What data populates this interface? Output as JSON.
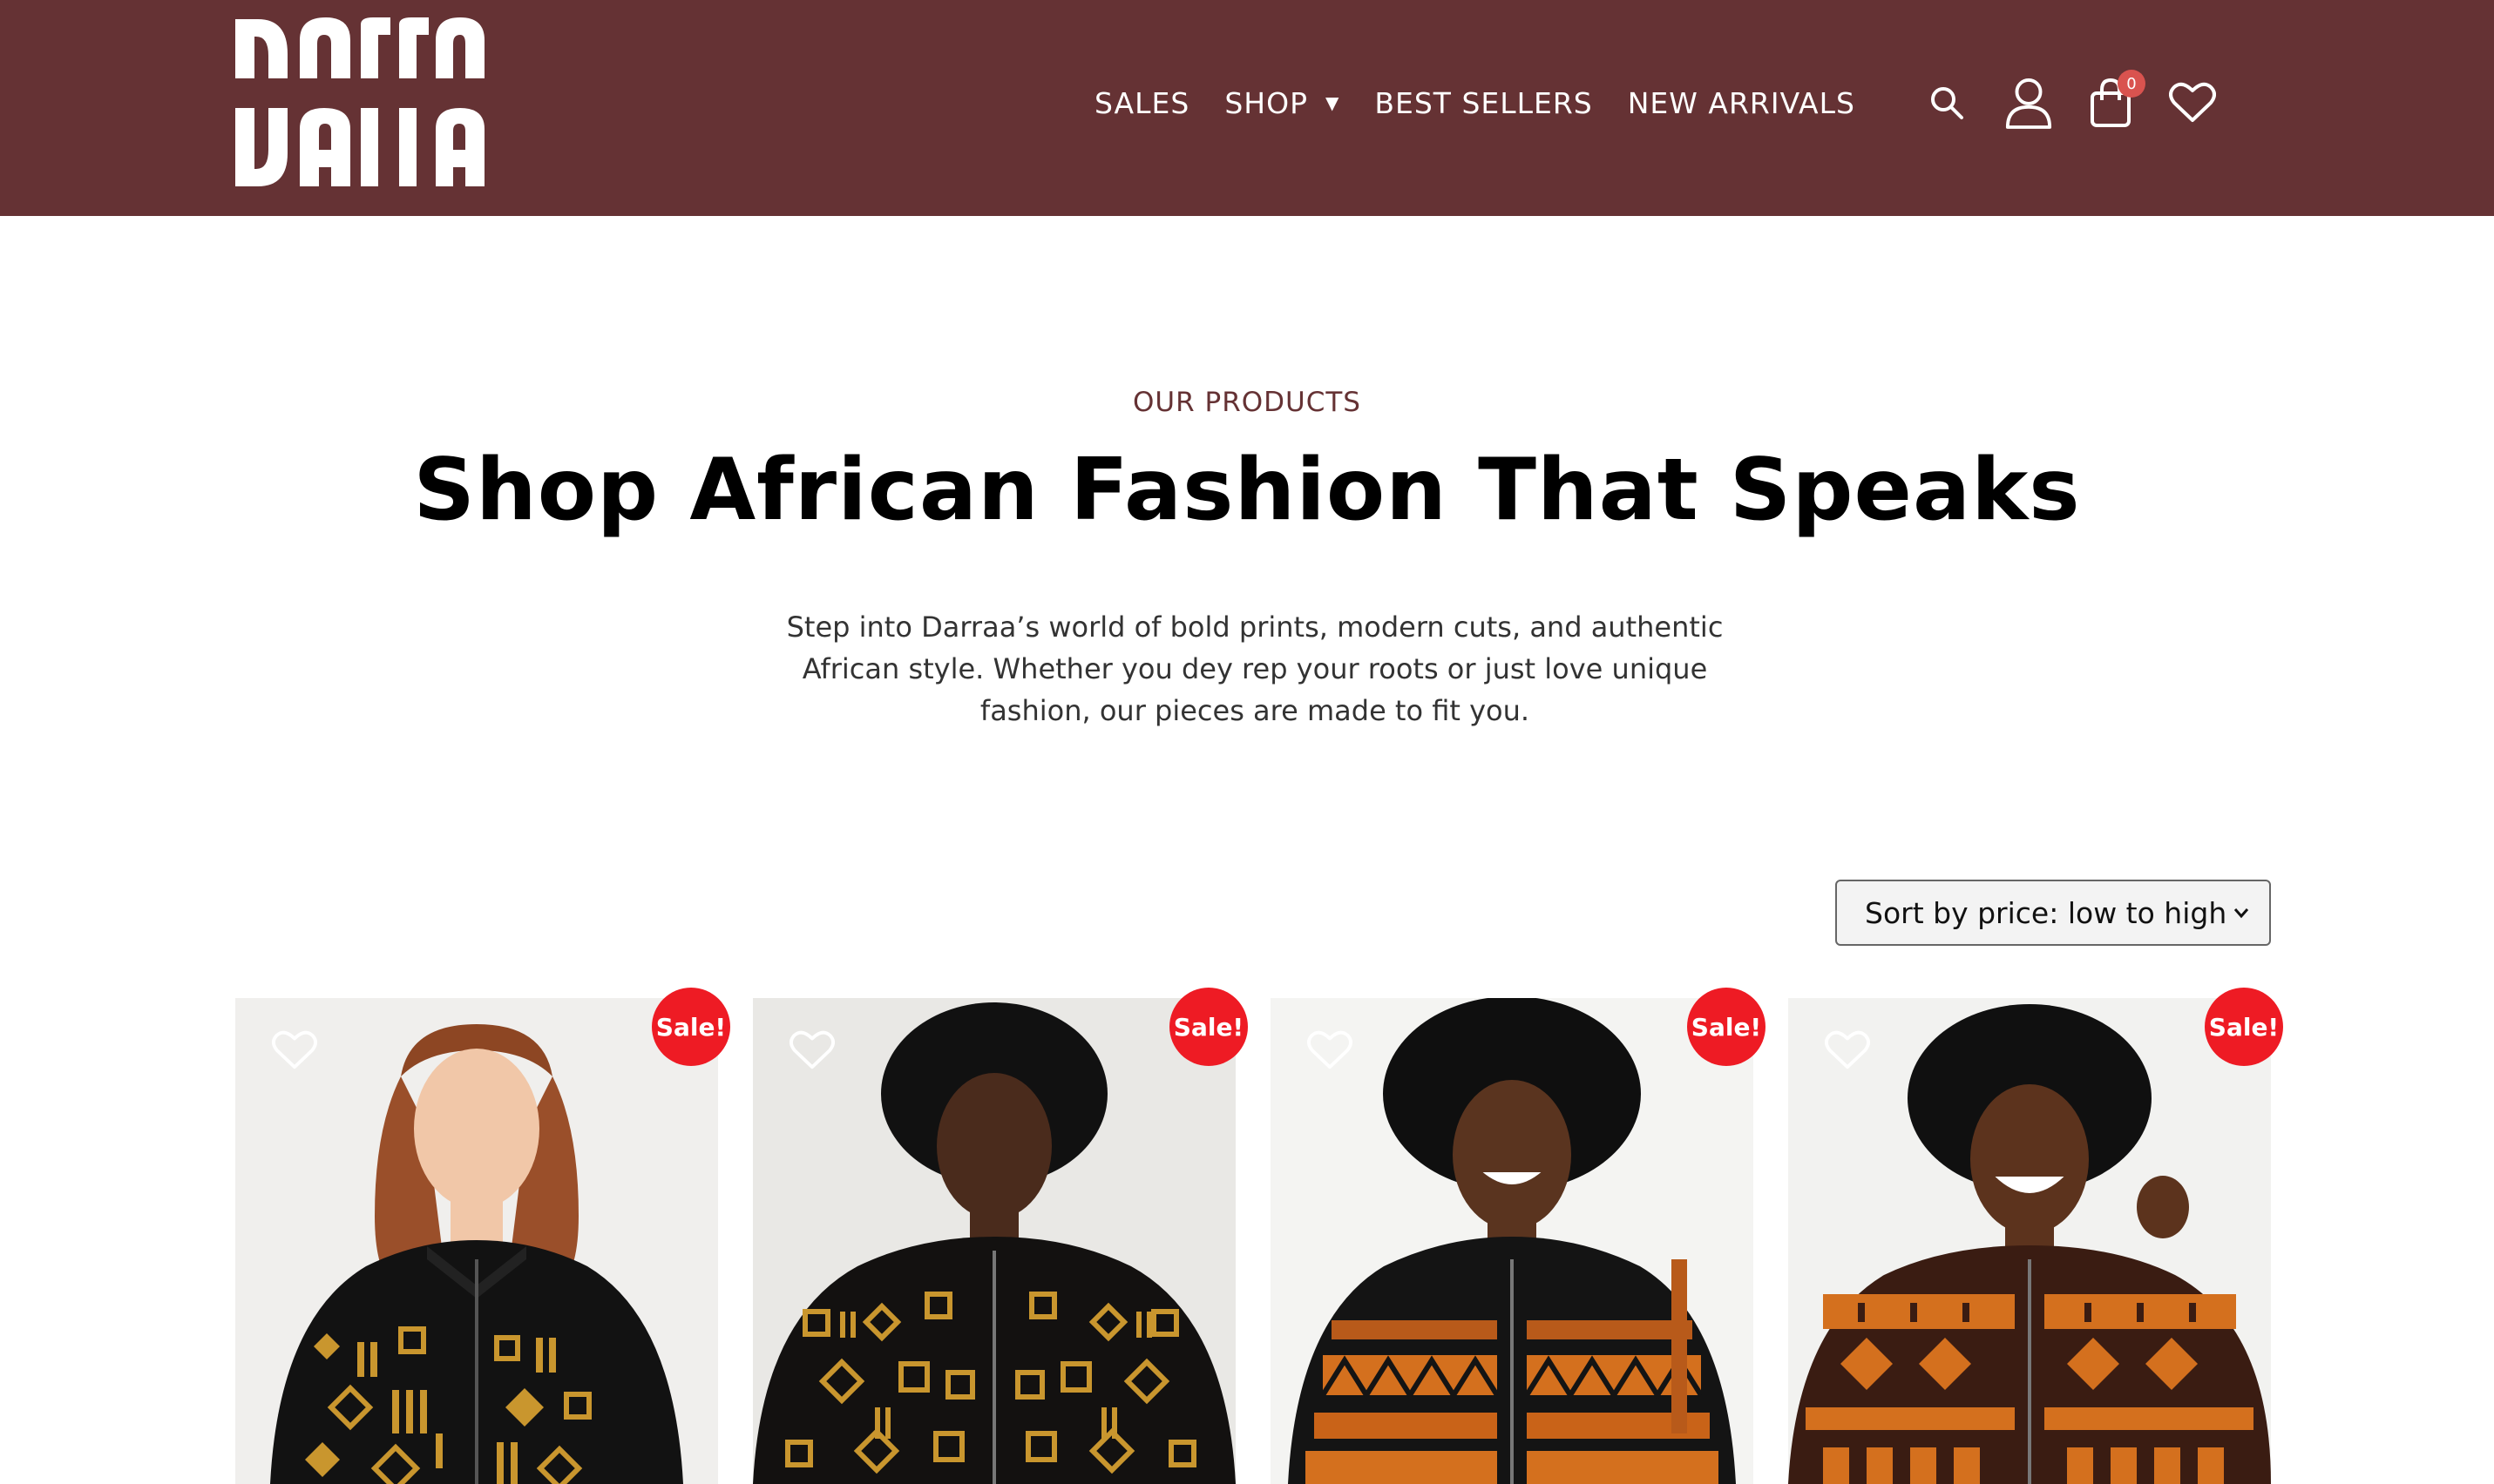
{
  "brand": {
    "name": "Darraa",
    "header_bg": "#653234",
    "accent": "#653234"
  },
  "nav": {
    "items": [
      {
        "label": "SALES"
      },
      {
        "label": "SHOP",
        "has_dropdown": true
      },
      {
        "label": "BEST SELLERS"
      },
      {
        "label": "NEW ARRIVALS"
      }
    ]
  },
  "header_icons": {
    "search": "search-icon",
    "account": "user-icon",
    "cart": "shopping-bag-icon",
    "cart_count": "0",
    "wishlist": "heart-icon"
  },
  "intro": {
    "eyebrow": "OUR PRODUCTS",
    "title": "Shop African Fashion That Speaks",
    "description": "Step into Darraa’s world of bold prints, modern cuts, and authentic African style. Whether you dey rep your roots or just love unique fashion, our pieces are made to fit you."
  },
  "sort": {
    "selected": "Sort by price: low to high"
  },
  "products": [
    {
      "badge": "Sale!",
      "pattern": "gold-mudcloth",
      "model": "woman-red-hair"
    },
    {
      "badge": "Sale!",
      "pattern": "gold-geometric",
      "model": "woman-afro"
    },
    {
      "badge": "Sale!",
      "pattern": "orange-bands",
      "model": "woman-afro-smiling"
    },
    {
      "badge": "Sale!",
      "pattern": "orange-allover",
      "model": "woman-afro-laughing"
    }
  ],
  "colors": {
    "sale_badge": "#ee1b24",
    "gold_print": "#c9962e",
    "orange_print": "#d4701e"
  }
}
